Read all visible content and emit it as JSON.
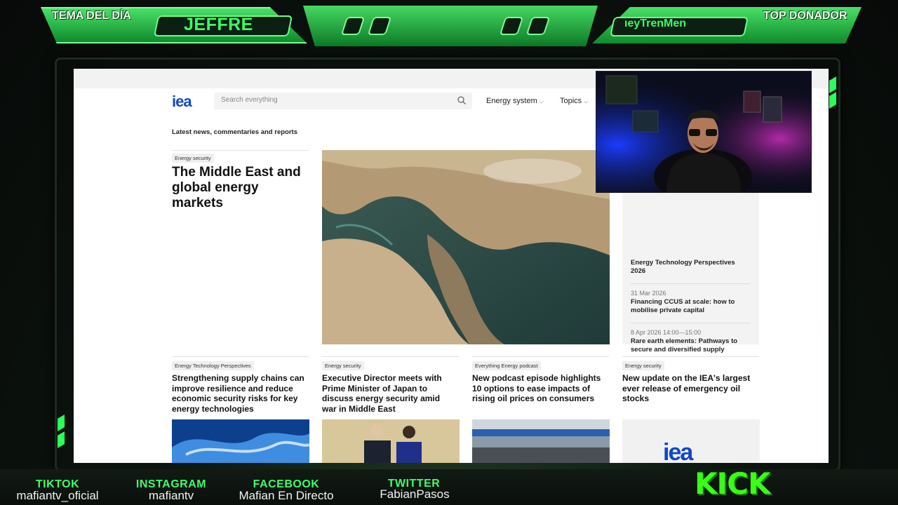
{
  "overlay": {
    "topic_label": "TEMA DEL DÍA",
    "topic_value": "JEFFRE",
    "donor_label": "TOP DONADOR",
    "donor_value": "ιeyTrenMen",
    "brand": "KICK",
    "accent_color": "#39ff68"
  },
  "socials": [
    {
      "network": "TIKTOK",
      "handle": "mafiantv_oficial"
    },
    {
      "network": "INSTAGRAM",
      "handle": "mafiantv"
    },
    {
      "network": "FACEBOOK",
      "handle": "Mafian En Directo"
    },
    {
      "network": "TWITTER",
      "handle": "FabianPasos"
    }
  ],
  "site": {
    "logo": "iea",
    "search_placeholder": "Search everything",
    "nav": [
      "Energy system",
      "Topics"
    ],
    "section_label": "Latest news, commentaries and reports",
    "hero": {
      "tag": "Energy security",
      "title": "The Middle East and global energy markets"
    },
    "events": [
      {
        "date": "",
        "title": "Energy Technology Perspectives 2026"
      },
      {
        "date": "31 Mar 2026",
        "title": "Financing CCUS at scale: how to mobilise private capital"
      },
      {
        "date": "8 Apr 2026 14:00—15:00",
        "title": "Rare earth elements: Pathways to secure and diversified supply"
      }
    ],
    "cards": [
      {
        "tag": "Energy Technology Perspectives",
        "title": "Strengthening supply chains can improve resilience and reduce economic security risks for key energy technologies"
      },
      {
        "tag": "Energy security",
        "title": "Executive Director meets with Prime Minister of Japan to discuss energy security amid war in Middle East"
      },
      {
        "tag": "Everything Energy podcast",
        "title": "New podcast episode highlights 10 options to ease impacts of rising oil prices on consumers"
      },
      {
        "tag": "Energy security",
        "title": "New update on the IEA's largest ever release of emergency oil stocks"
      }
    ],
    "thumb_logo": "iea"
  }
}
